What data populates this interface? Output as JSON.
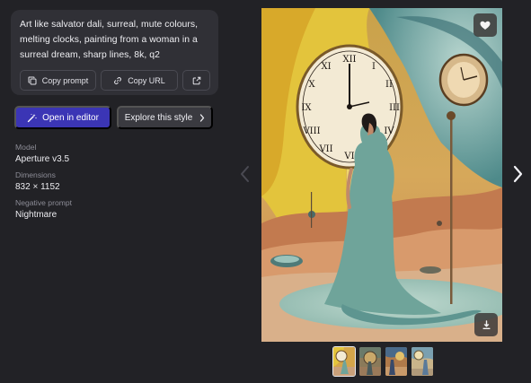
{
  "prompt": {
    "text": "Art like salvator dali, surreal, mute colours, melting clocks, painting from a woman in a surreal dream, sharp lines, 8k, q2",
    "copy_prompt_label": "Copy prompt",
    "copy_url_label": "Copy URL"
  },
  "actions": {
    "open_editor_label": "Open in editor",
    "explore_style_label": "Explore this style"
  },
  "details": {
    "model_label": "Model",
    "model_value": "Aperture v3.5",
    "dimensions_label": "Dimensions",
    "dimensions_value": "832 × 1152",
    "negative_prompt_label": "Negative prompt",
    "negative_prompt_value": "Nightmare"
  },
  "icons": {
    "copy": "copy-icon",
    "link": "link-icon",
    "external": "external-link-icon",
    "wand": "magic-wand-icon",
    "chevron": "chevron-right-icon",
    "favorite": "heart-icon",
    "download": "download-icon",
    "prev": "chevron-left-icon",
    "next": "chevron-right-icon"
  },
  "colors": {
    "background": "#222226",
    "card": "#303036",
    "accent": "#3b35b5"
  },
  "thumbnails": {
    "count": 4,
    "active_index": 0
  }
}
